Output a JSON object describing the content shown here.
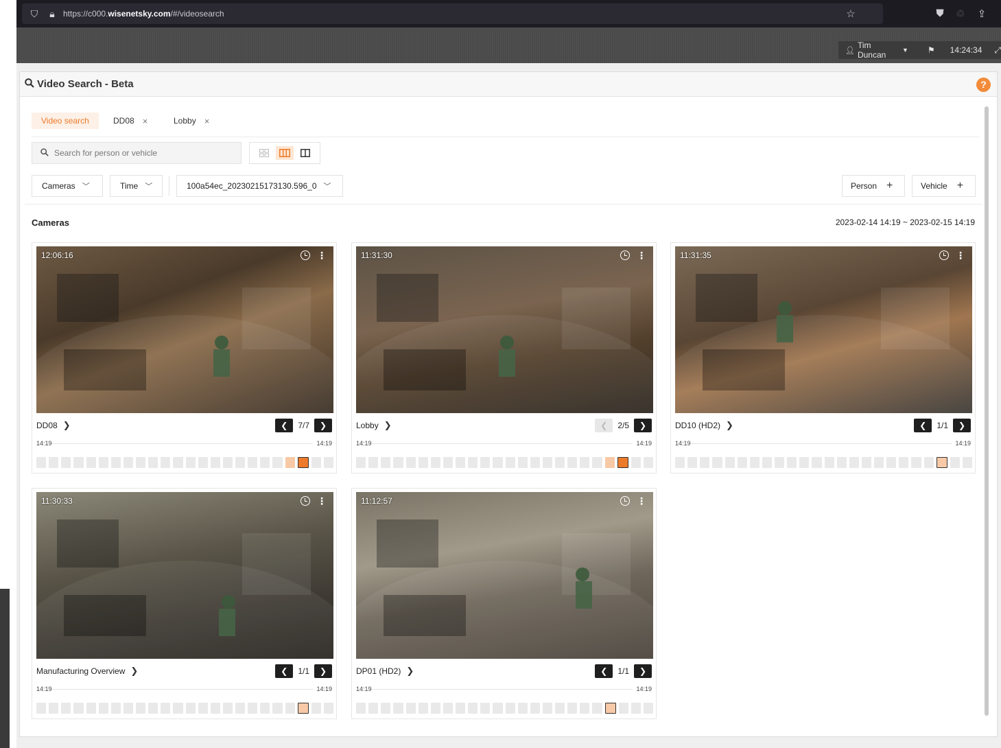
{
  "browser": {
    "url_prefix": "https://c000.",
    "url_domain": "wisenetsky.com",
    "url_path": "/#/videosearch"
  },
  "header": {
    "user_name": "Tim Duncan",
    "clock": "14:24:34"
  },
  "panel": {
    "title": "Video Search - Beta",
    "help": "?"
  },
  "tabs": [
    {
      "label": "Video search",
      "active": true
    },
    {
      "label": "DD08",
      "close": "×"
    },
    {
      "label": "Lobby",
      "close": "×"
    }
  ],
  "search": {
    "placeholder": "Search for person or vehicle"
  },
  "filters": {
    "cameras": "Cameras",
    "time": "Time",
    "clip": "100a54ec_20230215173130.596_0",
    "person": "Person",
    "vehicle": "Vehicle"
  },
  "section": {
    "title": "Cameras",
    "date_range": "2023-02-14 14:19 ~ 2023-02-15 14:19"
  },
  "cameras": [
    {
      "time": "12:06:16",
      "name": "DD08",
      "count": "7/7",
      "tl_start": "14:19",
      "tl_end": "14:19",
      "highlight": [
        20,
        21
      ],
      "selected": 21,
      "prev_disabled": false
    },
    {
      "time": "11:31:30",
      "name": "Lobby",
      "count": "2/5",
      "tl_start": "14:19",
      "tl_end": "14:19",
      "highlight": [
        20,
        21
      ],
      "selected": 21,
      "prev_disabled": true
    },
    {
      "time": "11:31:35",
      "name": "DD10 (HD2)",
      "count": "1/1",
      "tl_start": "14:19",
      "tl_end": "14:19",
      "highlight": [
        21
      ],
      "selected": 21,
      "prev_disabled": false
    },
    {
      "time": "11:30:33",
      "name": "Manufacturing Overview",
      "count": "1/1",
      "tl_start": "14:19",
      "tl_end": "14:19",
      "highlight": [
        21
      ],
      "selected": 21,
      "prev_disabled": false
    },
    {
      "time": "11:12:57",
      "name": "DP01 (HD2)",
      "count": "1/1",
      "tl_start": "14:19",
      "tl_end": "14:19",
      "highlight": [
        20
      ],
      "selected": 20,
      "prev_disabled": false
    }
  ],
  "colors": {
    "accent": "#ec7a2a",
    "accent_light": "#f7c9a6",
    "header_bg": "#4a4a4a",
    "browser_bg": "#1c1b22"
  }
}
